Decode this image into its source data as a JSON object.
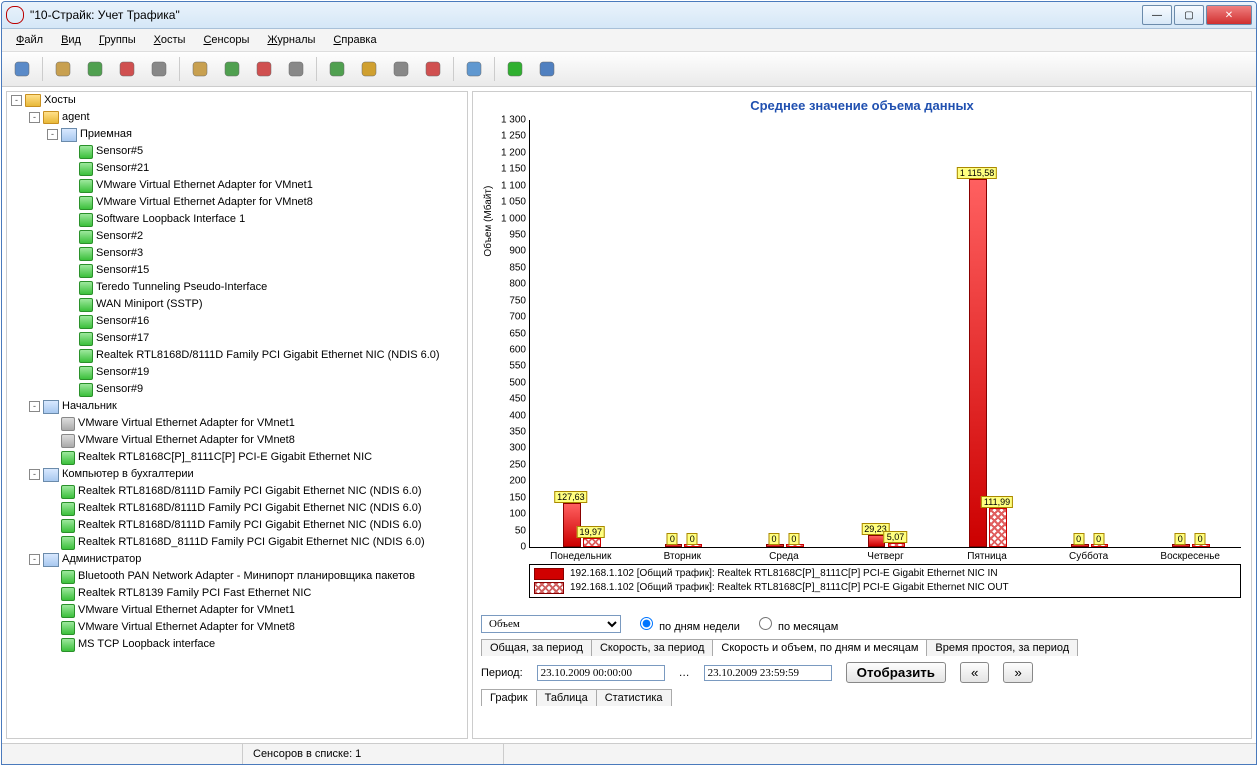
{
  "window": {
    "title": "\"10-Страйк: Учет Трафика\""
  },
  "menu": [
    "Файл",
    "Вид",
    "Группы",
    "Хосты",
    "Сенсоры",
    "Журналы",
    "Справка"
  ],
  "tree": {
    "root": "Хосты",
    "groups": [
      {
        "name": "agent",
        "children": [
          {
            "name": "Приемная",
            "sensors": [
              "Sensor#5",
              "Sensor#21",
              "VMware Virtual Ethernet Adapter for VMnet1",
              "VMware Virtual Ethernet Adapter for VMnet8",
              "Software Loopback Interface 1",
              "Sensor#2",
              "Sensor#3",
              "Sensor#15",
              "Teredo Tunneling Pseudo-Interface",
              "WAN Miniport (SSTP)",
              "Sensor#16",
              "Sensor#17",
              "Realtek RTL8168D/8111D Family PCI Gigabit Ethernet NIC (NDIS 6.0)",
              "Sensor#19",
              "Sensor#9"
            ]
          }
        ]
      },
      {
        "name": "Начальник",
        "sensors": [
          {
            "label": "VMware Virtual Ethernet Adapter for VMnet1",
            "grey": true
          },
          {
            "label": "VMware Virtual Ethernet Adapter for VMnet8",
            "grey": true
          },
          {
            "label": "Realtek RTL8168C[P]_8111C[P] PCI-E Gigabit Ethernet NIC",
            "grey": false
          }
        ]
      },
      {
        "name": "Компьютер в бухгалтерии",
        "sensors": [
          "Realtek RTL8168D/8111D Family PCI Gigabit Ethernet NIC (NDIS 6.0)",
          "Realtek RTL8168D/8111D Family PCI Gigabit Ethernet NIC (NDIS 6.0)",
          "Realtek RTL8168D/8111D Family PCI Gigabit Ethernet NIC (NDIS 6.0)",
          "Realtek RTL8168D_8111D Family PCI Gigabit Ethernet NIC (NDIS 6.0)"
        ]
      },
      {
        "name": "Администратор",
        "sensors": [
          "Bluetooth PAN Network Adapter - Минипорт планировщика пакетов",
          "Realtek RTL8139 Family PCI Fast Ethernet NIC",
          "VMware Virtual Ethernet Adapter for VMnet1",
          "VMware Virtual Ethernet Adapter for VMnet8",
          "MS TCP Loopback interface"
        ]
      }
    ]
  },
  "chart_data": {
    "type": "bar",
    "title": "Среднее значение объема данных",
    "ylabel": "Объем (Мбайт)",
    "ylim": [
      0,
      1300
    ],
    "ystep": 50,
    "categories": [
      "Понедельник",
      "Вторник",
      "Среда",
      "Четверг",
      "Пятница",
      "Суббота",
      "Воскресенье"
    ],
    "series": [
      {
        "name": "192.168.1.102 [Общий трафик]: Realtek RTL8168C[P]_8111C[P] PCI-E Gigabit Ethernet NIC IN",
        "kind": "in",
        "values": [
          127.63,
          0,
          0,
          29.23,
          1115.58,
          0,
          0
        ],
        "labels": [
          "127,63",
          "0",
          "0",
          "29,23",
          "1 115,58",
          "0",
          "0"
        ]
      },
      {
        "name": "192.168.1.102 [Общий трафик]: Realtek RTL8168C[P]_8111C[P] PCI-E Gigabit Ethernet NIC OUT",
        "kind": "out",
        "values": [
          19.97,
          0,
          0,
          5.07,
          111.99,
          0,
          0
        ],
        "labels": [
          "19,97",
          "0",
          "0",
          "5,07",
          "111,99",
          "0",
          "0"
        ]
      }
    ]
  },
  "controls": {
    "metric": "Объем",
    "radio_days": "по дням недели",
    "radio_months": "по месяцам",
    "tabs": [
      "Общая, за период",
      "Скорость, за период",
      "Скорость и объем, по дням и месяцам",
      "Время простоя, за период"
    ],
    "active_tab": 2,
    "period_label": "Период:",
    "period_from": "23.10.2009 00:00:00",
    "period_to": "23.10.2009 23:59:59",
    "show_btn": "Отобразить",
    "bottom_tabs": [
      "График",
      "Таблица",
      "Статистика"
    ],
    "active_bottom": 0
  },
  "status": {
    "sensors": "Сенсоров в списке: 1"
  }
}
